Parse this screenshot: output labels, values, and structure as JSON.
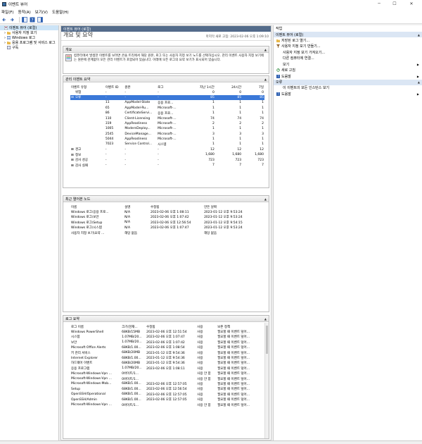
{
  "window": {
    "title": "이벤트 뷰어",
    "minimize": "─",
    "maximize": "☐",
    "close": "✕"
  },
  "menu": [
    "파일(F)",
    "동작(A)",
    "보기(V)",
    "도움말(H)"
  ],
  "tree": [
    {
      "label": "이벤트 뷰어 (로컬)",
      "indent": 0,
      "expander": "",
      "selected": true
    },
    {
      "label": "사용자 지정 보기",
      "indent": 1,
      "expander": "›",
      "selected": false
    },
    {
      "label": "Windows 로그",
      "indent": 1,
      "expander": "›",
      "selected": false
    },
    {
      "label": "응용 프로그램 및 서비스 로그",
      "indent": 1,
      "expander": "›",
      "selected": false
    },
    {
      "label": "구독",
      "indent": 1,
      "expander": "",
      "selected": false
    }
  ],
  "center": {
    "header": "이벤트 뷰어 (로컬)",
    "title": "개요 및 요약",
    "last_refresh": "마지막 새로 고침: 2023-02-06 오후 1:09:10"
  },
  "overview": {
    "title": "개요",
    "text": "컴퓨터에서 발생한 이벤트를 보려면 콘솔 트리에서 해당 원본, 로그 또는 사용자 지정 보기 노드를 선택하십시오. 관리 이벤트 사용자 지정 보기에는 원본에 관계없이 모든 관리 이벤트가 포함되어 있습니다. 아래에 모든 로그의 요약 보기가 표시되어 있습니다."
  },
  "admin_summary": {
    "title": "관리 이벤트 요약",
    "columns": [
      "이벤트 유형",
      "이벤트 ID",
      "원본",
      "로그",
      "지난 1시간",
      "24시간",
      "7일"
    ],
    "rows": [
      {
        "cells": [
          "위험",
          "-",
          "-",
          "-",
          "0",
          "0",
          "0"
        ],
        "expander": "",
        "selected": false
      },
      {
        "cells": [
          "오류",
          "-",
          "-",
          "-",
          "85",
          "85",
          "85"
        ],
        "expander": "⊟",
        "selected": true
      },
      {
        "cells": [
          "",
          "11",
          "AppModel-State",
          "응용 프로...",
          "1",
          "1",
          "1"
        ],
        "expander": "",
        "selected": false
      },
      {
        "cells": [
          "",
          "65",
          "AppModel-Ru...",
          "Microsoft-...",
          "1",
          "1",
          "1"
        ],
        "expander": "",
        "selected": false
      },
      {
        "cells": [
          "",
          "86",
          "CertificateServi...",
          "응용 프로...",
          "1",
          "1",
          "1"
        ],
        "expander": "",
        "selected": false
      },
      {
        "cells": [
          "",
          "110",
          "Client-Licensing",
          "Microsoft-...",
          "74",
          "74",
          "74"
        ],
        "expander": "",
        "selected": false
      },
      {
        "cells": [
          "",
          "319",
          "AppReadiness",
          "Microsoft-...",
          "2",
          "2",
          "2"
        ],
        "expander": "",
        "selected": false
      },
      {
        "cells": [
          "",
          "1005",
          "ModernDeploy...",
          "Microsoft-...",
          "1",
          "1",
          "1"
        ],
        "expander": "",
        "selected": false
      },
      {
        "cells": [
          "",
          "2545",
          "DeviceManage...",
          "Microsoft-...",
          "3",
          "3",
          "3"
        ],
        "expander": "",
        "selected": false
      },
      {
        "cells": [
          "",
          "5044",
          "AppReadiness",
          "Microsoft-...",
          "1",
          "1",
          "1"
        ],
        "expander": "",
        "selected": false
      },
      {
        "cells": [
          "",
          "7023",
          "Service Control...",
          "시스템",
          "1",
          "1",
          "1"
        ],
        "expander": "",
        "selected": false
      },
      {
        "cells": [
          "경고",
          "-",
          "-",
          "-",
          "12",
          "12",
          "12"
        ],
        "expander": "⊞",
        "selected": false
      },
      {
        "cells": [
          "정보",
          "-",
          "-",
          "-",
          "1,680",
          "1,680",
          "1,680"
        ],
        "expander": "⊞",
        "selected": false
      },
      {
        "cells": [
          "감사 성공",
          "-",
          "-",
          "-",
          "723",
          "723",
          "723"
        ],
        "expander": "⊞",
        "selected": false
      },
      {
        "cells": [
          "감사 실패",
          "-",
          "-",
          "-",
          "7",
          "7",
          "7"
        ],
        "expander": "⊞",
        "selected": false
      }
    ]
  },
  "recent_nodes": {
    "title": "최근 열어본 노드",
    "columns": [
      "이름",
      "설명",
      "수정됨",
      "만든 날짜"
    ],
    "rows": [
      [
        "Windows 로그\\응용 프로...",
        "N/A",
        "2023-02-06 오후 1:08:11",
        "2023-01-12 오후 9:53:24"
      ],
      [
        "Windows 로그\\보안",
        "N/A",
        "2023-02-06 오후 1:07:42",
        "2023-01-12 오후 9:53:24"
      ],
      [
        "Windows 로그\\Setup",
        "N/A",
        "2023-02-06 오후 12:56:54",
        "2023-01-12 오후 9:54:15"
      ],
      [
        "Windows 로그\\시스템",
        "N/A",
        "2023-02-06 오후 1:07:47",
        "2023-01-12 오후 9:53:24"
      ],
      [
        "사용자 지정 보기\\요약 ...",
        "해당 없음",
        "",
        "해당 없음"
      ]
    ]
  },
  "log_summary": {
    "title": "로그 요약",
    "columns": [
      "로그 이름",
      "크기(현재...",
      "수정됨",
      "사용",
      "보존 정책"
    ],
    "rows": [
      [
        "Windows PowerShell",
        "68KB/15MB",
        "2023-02-06 오후 12:51:54",
        "사용",
        "필요할 때 이벤트 덮어..."
      ],
      [
        "시스템",
        "1.07MB/20...",
        "2023-02-06 오후 1:07:47",
        "사용",
        "필요할 때 이벤트 덮어..."
      ],
      [
        "보안",
        "1.07MB/20...",
        "2023-02-06 오후 1:07:42",
        "사용",
        "필요할 때 이벤트 덮어..."
      ],
      [
        "Microsoft Office Alerts",
        "68KB/1.00...",
        "2023-02-06 오후 1:08:54",
        "사용",
        "필요할 때 이벤트 덮어..."
      ],
      [
        "키 관리 서비스",
        "68KB/20MB",
        "2023-01-12 오후 9:54:36",
        "사용",
        "필요할 때 이벤트 덮어..."
      ],
      [
        "Internet Explorer",
        "68KB/1.00...",
        "2023-01-12 오후 9:54:36",
        "사용",
        "필요할 때 이벤트 덮어..."
      ],
      [
        "하드웨어 이벤트",
        "68KB/20MB",
        "2023-01-12 오후 9:54:36",
        "사용",
        "필요할 때 이벤트 덮어..."
      ],
      [
        "응용 프로그램",
        "1.07MB/20...",
        "2023-02-06 오후 1:08:11",
        "사용",
        "필요할 때 이벤트 덮어..."
      ],
      [
        "Microsoft-Windows-Vpn ...",
        "0바이트/1...",
        "",
        "사용 안 함",
        "필요할 때 이벤트 덮어..."
      ],
      [
        "Microsoft-Windows-Vpn ...",
        "0바이트/1...",
        "",
        "사용 안 함",
        "필요할 때 이벤트 덮어..."
      ],
      [
        "Microsoft-Windows-Mob...",
        "68KB/1.00...",
        "2023-02-06 오후 12:57:05",
        "사용",
        "필요할 때 이벤트 덮어..."
      ],
      [
        "Setup",
        "68KB/1.00...",
        "2023-02-06 오후 12:56:54",
        "사용",
        "필요할 때 이벤트 덮어..."
      ],
      [
        "OpenSSH/Operational",
        "68KB/1.00...",
        "2023-02-06 오후 12:57:05",
        "사용",
        "필요할 때 이벤트 덮어..."
      ],
      [
        "OpenSSH/Admin",
        "68KB/1.00...",
        "2023-02-06 오후 12:57:05",
        "사용",
        "필요할 때 이벤트 덮어..."
      ],
      [
        "Microsoft-Windows-Vpn ...",
        "0바이트/1...",
        "",
        "사용 안 함",
        "필요할 때 이벤트 덮어..."
      ]
    ]
  },
  "actions": {
    "title": "작업",
    "section1": "이벤트 뷰어 (로컬)",
    "items1": [
      {
        "label": "저장된 로그 열기...",
        "icon": "folder-icon",
        "arrow": ""
      },
      {
        "label": "사용자 지정 보기 만들기...",
        "icon": "filter-icon",
        "arrow": ""
      },
      {
        "label": "사용자 지정 보기 가져오기...",
        "icon": "",
        "arrow": ""
      },
      {
        "label": "다른 컴퓨터에 연결...",
        "icon": "",
        "arrow": ""
      },
      {
        "label": "보기",
        "icon": "",
        "arrow": "▶"
      },
      {
        "label": "새로 고침",
        "icon": "refresh-icon",
        "arrow": ""
      },
      {
        "label": "도움말",
        "icon": "help-icon",
        "arrow": "▶"
      }
    ],
    "section2": "오류",
    "items2": [
      {
        "label": "이 이벤트의 모든 인스턴스 보기",
        "icon": "",
        "arrow": ""
      },
      {
        "label": "도움말",
        "icon": "help-icon",
        "arrow": "▶"
      }
    ]
  },
  "colors": {
    "header": "#536b8a",
    "selection": "#3a78d8",
    "tree_selection": "#cce4f7",
    "section": "#dbe6f4"
  }
}
